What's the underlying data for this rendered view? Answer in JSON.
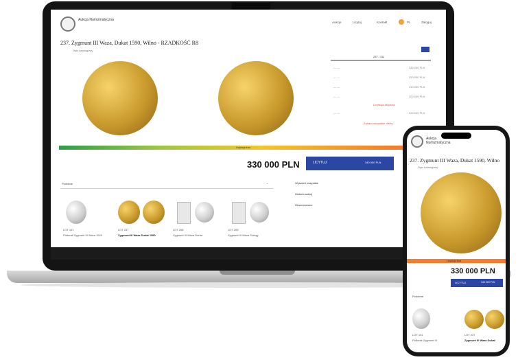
{
  "laptop": {
    "nav": {
      "items": [
        "Aukcje",
        "Licytuj",
        "Kontakt",
        "PL",
        "Zaloguj"
      ],
      "brand": "Aukcja Numizmatyczna"
    },
    "lot": {
      "title": "237. Zygmunt III Waza, Dukat 1590, Wilno - RZADKOŚĆ R8",
      "subtitle": "Opis katalogowy"
    },
    "bids": {
      "header": "237 / 311",
      "rows": [
        {
          "label": "— —",
          "value": "330 000 PLN"
        },
        {
          "label": "— —",
          "value": "320 000 PLN"
        },
        {
          "label": "— —",
          "value": "310 000 PLN"
        },
        {
          "label": "— —",
          "value": "300 000 PLN"
        },
        {
          "label": "— —",
          "value": "290 000 PLN"
        }
      ],
      "note": "Licytacja aktywna",
      "note2": "Zobacz wszystkie oferty"
    },
    "progress_label": "Licytacja trwa",
    "progress_fraction": 1.0,
    "price": "330 000 PLN",
    "bid_button": "LICYTUJ",
    "bid_next": "340 000 PLN",
    "dropdown_label": "Podobne",
    "side_links": [
      "Wyświetl wszystkie",
      "Historia aukcji",
      "Obserwowane"
    ],
    "thumbs": [
      {
        "lot": "LOT 101",
        "desc": "Półtorak Zygmunt III Waza 1620"
      },
      {
        "lot": "LOT 237",
        "desc": "Zygmunt III Waza Dukat 1590"
      },
      {
        "lot": "LOT 208",
        "desc": "Zygmunt III Waza Denar"
      },
      {
        "lot": "LOT 209",
        "desc": "Zygmunt III Waza Szeląg"
      }
    ]
  },
  "phone": {
    "lot_title": "237. Zygmunt III Waza, Dukat 1590, Wilno",
    "subtitle": "Opis katalogowy",
    "progress_label": "Licytacja trwa",
    "price": "330 000 PLN",
    "bid_button": "LICYTUJ",
    "bid_next": "340 000 PLN",
    "dropdown_label": "Podobne",
    "thumbs": [
      {
        "lot": "LOT 101",
        "desc": "Półtorak Zygmunt III"
      },
      {
        "lot": "LOT 237",
        "desc": "Zygmunt III Waza Dukat"
      }
    ]
  },
  "colors": {
    "gold": "#d8a93c",
    "blue_button": "#2b47a3",
    "progress_orange": "#f57d2b",
    "device_frame": "#141414"
  }
}
